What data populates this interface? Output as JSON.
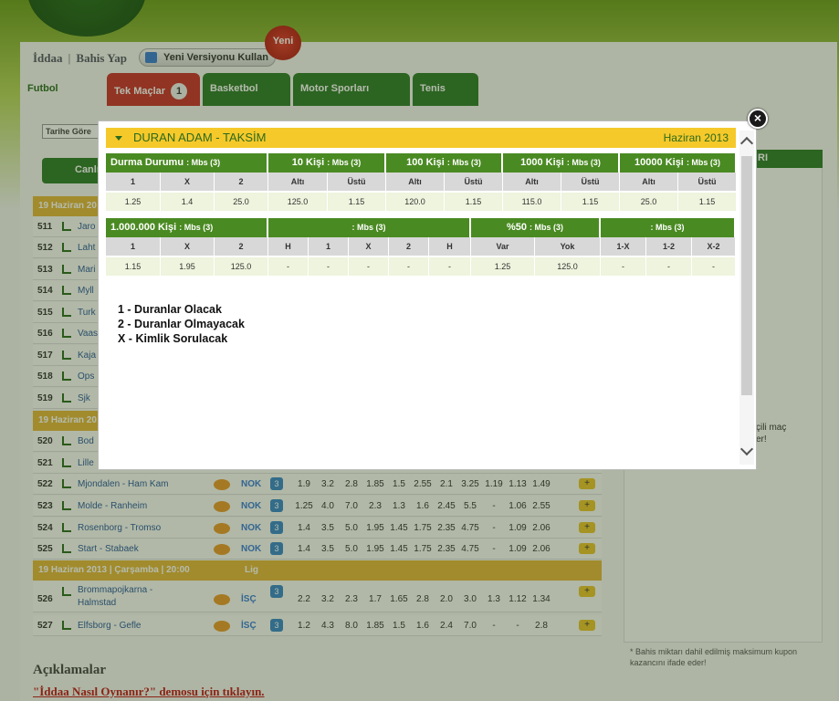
{
  "crumb": {
    "home": "İddaa",
    "current": "Bahis Yap"
  },
  "version_button": "Yeni Versiyonu Kullan",
  "new_badge": "Yeni",
  "tabs": [
    {
      "label": "Futbol"
    },
    {
      "label": "Tek Maçlar",
      "count": "1"
    },
    {
      "label": "Basketbol"
    },
    {
      "label": "Motor Sporları"
    },
    {
      "label": "Tenis"
    }
  ],
  "filter": {
    "date_label": "Tarihe Göre",
    "can_label": "Canlı"
  },
  "right_header_fragment": "RI",
  "right_side_text": "çili maç\ner!",
  "date_bands": [
    {
      "label": "19 Haziran 20"
    },
    {
      "label": "19 Haziran 20"
    },
    {
      "label": "19 Haziran 2013  |  Çarşamba  |  20:00",
      "lig": "Lig"
    }
  ],
  "matches_hidden": [
    {
      "no": "511",
      "name": "Jaro"
    },
    {
      "no": "512",
      "name": "Laht"
    },
    {
      "no": "513",
      "name": "Mari"
    },
    {
      "no": "514",
      "name": "Myll"
    },
    {
      "no": "515",
      "name": "Turk"
    },
    {
      "no": "516",
      "name": "Vaas"
    },
    {
      "no": "517",
      "name": "Kaja"
    },
    {
      "no": "518",
      "name": "Ops"
    },
    {
      "no": "519",
      "name": "Sjk"
    },
    {
      "no": "520",
      "name": "Bod"
    },
    {
      "no": "521",
      "name": "Lille"
    }
  ],
  "matches": [
    {
      "no": "522",
      "name": "Mjondalen - Ham Kam",
      "lig": "NOK",
      "mbs": "3",
      "odds": [
        "1.9",
        "3.2",
        "2.8",
        "1.85",
        "1.5",
        "2.55",
        "2.1",
        "3.25",
        "1.19",
        "1.13",
        "1.49"
      ]
    },
    {
      "no": "523",
      "name": "Molde - Ranheim",
      "lig": "NOK",
      "mbs": "3",
      "odds": [
        "1.25",
        "4.0",
        "7.0",
        "2.3",
        "1.3",
        "1.6",
        "2.45",
        "5.5",
        "-",
        "1.06",
        "2.55"
      ]
    },
    {
      "no": "524",
      "name": "Rosenborg - Tromso",
      "lig": "NOK",
      "mbs": "3",
      "odds": [
        "1.4",
        "3.5",
        "5.0",
        "1.95",
        "1.45",
        "1.75",
        "2.35",
        "4.75",
        "-",
        "1.09",
        "2.06"
      ]
    },
    {
      "no": "525",
      "name": "Start - Stabaek",
      "lig": "NOK",
      "mbs": "3",
      "odds": [
        "1.4",
        "3.5",
        "5.0",
        "1.95",
        "1.45",
        "1.75",
        "2.35",
        "4.75",
        "-",
        "1.09",
        "2.06"
      ]
    },
    {
      "no": "526",
      "name": "Brommapojkarna - Halmstad",
      "lig": "İSÇ",
      "mbs": "3",
      "odds": [
        "2.2",
        "3.2",
        "2.3",
        "1.7",
        "1.65",
        "2.8",
        "2.0",
        "3.0",
        "1.3",
        "1.12",
        "1.34"
      ]
    },
    {
      "no": "527",
      "name": "Elfsborg - Gefle",
      "lig": "İSÇ",
      "mbs": "3",
      "odds": [
        "1.2",
        "4.3",
        "8.0",
        "1.85",
        "1.5",
        "1.6",
        "2.4",
        "7.0",
        "-",
        "-",
        "2.8"
      ]
    }
  ],
  "right_note": "* Bahis miktarı dahil edilmiş maksimum kupon kazancını ifade eder!",
  "aciklamalar": "Açıklamalar",
  "demo_link": "\"İddaa Nasıl Oynanır?\" demosu için tıklayın.",
  "modal": {
    "title": "DURAN ADAM - TAKSİM",
    "date": "Haziran 2013",
    "row1": {
      "groups": [
        {
          "title": "Durma Durumu",
          "mbs": ": Mbs (3)",
          "subs": [
            "1",
            "X",
            "2"
          ],
          "vals": [
            "1.25",
            "1.4",
            "25.0"
          ]
        },
        {
          "title": "10 Kişi",
          "mbs": ": Mbs (3)",
          "subs": [
            "Altı",
            "Üstü"
          ],
          "vals": [
            "125.0",
            "1.15"
          ]
        },
        {
          "title": "100 Kişi",
          "mbs": ": Mbs (3)",
          "subs": [
            "Altı",
            "Üstü"
          ],
          "vals": [
            "120.0",
            "1.15"
          ]
        },
        {
          "title": "1000 Kişi",
          "mbs": ": Mbs (3)",
          "subs": [
            "Altı",
            "Üstü"
          ],
          "vals": [
            "115.0",
            "1.15"
          ]
        },
        {
          "title": "10000 Kişi",
          "mbs": ": Mbs (3)",
          "subs": [
            "Altı",
            "Üstü"
          ],
          "vals": [
            "25.0",
            "1.15"
          ]
        }
      ]
    },
    "row2": {
      "groups": [
        {
          "title": "1.000.000 Kişi",
          "mbs": ": Mbs (3)",
          "subs": [
            "1",
            "X",
            "2"
          ],
          "vals": [
            "1.15",
            "1.95",
            "125.0"
          ]
        },
        {
          "title": "",
          "mbs": ": Mbs (3)",
          "subs": [
            "H",
            "1",
            "X",
            "2",
            "H"
          ],
          "vals": [
            "-",
            "-",
            "-",
            "-",
            "-"
          ]
        },
        {
          "title": "%50",
          "mbs": ": Mbs (3)",
          "subs": [
            "Var",
            "Yok"
          ],
          "vals": [
            "1.25",
            "125.0"
          ]
        },
        {
          "title": "",
          "mbs": ": Mbs (3)",
          "subs": [
            "1-X",
            "1-2",
            "X-2"
          ],
          "vals": [
            "-",
            "-",
            "-"
          ]
        }
      ]
    },
    "legend": [
      "1 - Duranlar Olacak",
      "2 - Duranlar Olmayacak",
      "X - Kimlik Sorulacak"
    ]
  }
}
